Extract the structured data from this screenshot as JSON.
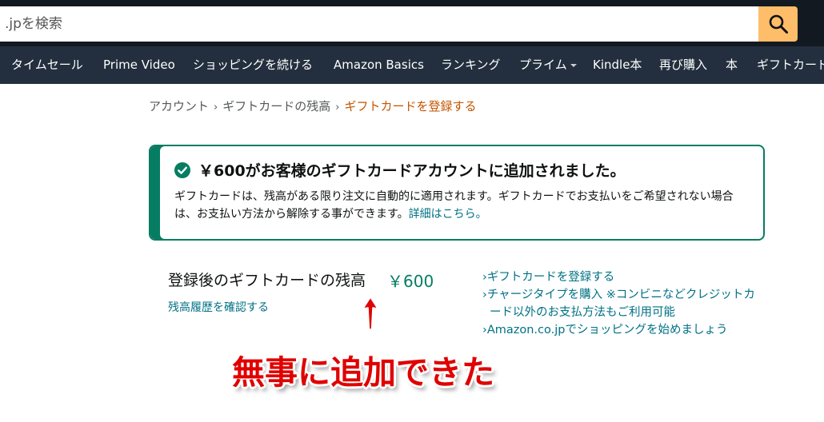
{
  "search": {
    "placeholder": ".jpを検索"
  },
  "nav": {
    "items": [
      {
        "label": "タイムセール"
      },
      {
        "label": "Prime Video"
      },
      {
        "label": "ショッピングを続ける"
      },
      {
        "label": "Amazon Basics"
      },
      {
        "label": "ランキング"
      },
      {
        "label": "プライム"
      },
      {
        "label": "Kindle本"
      },
      {
        "label": "再び購入"
      },
      {
        "label": "本"
      },
      {
        "label": "ギフトカード"
      }
    ]
  },
  "breadcrumb": {
    "items": [
      "アカウント",
      "ギフトカードの残高",
      "ギフトカードを登録する"
    ],
    "separator": "›"
  },
  "alert": {
    "title": "￥600がお客様のギフトカードアカウントに追加されました。",
    "body": "ギフトカードは、残高がある限り注文に自動的に適用されます。ギフトカードでお支払いをご希望されない場合は、お支払い方法から解除する事ができます。",
    "link": "詳細はこちら。"
  },
  "balance": {
    "label": "登録後のギフトカードの残高",
    "amount": "￥600",
    "history_link": "残高履歴を確認する"
  },
  "side_links": {
    "arrow": "›",
    "register": "ギフトカードを登録する",
    "charge_line1": "チャージタイプを購入 ※コンビニなどクレジットカ",
    "charge_line2": "ード以外のお支払方法もご利用可能",
    "shop": "Amazon.co.jpでショッピングを始めましょう"
  },
  "annotation": {
    "text": "無事に追加できた"
  },
  "colors": {
    "header": "#131921",
    "nav": "#232f3e",
    "search_button": "#febd69",
    "success": "#067d62",
    "link": "#007185",
    "breadcrumb_current": "#c45500",
    "annotation": "#e00000"
  }
}
